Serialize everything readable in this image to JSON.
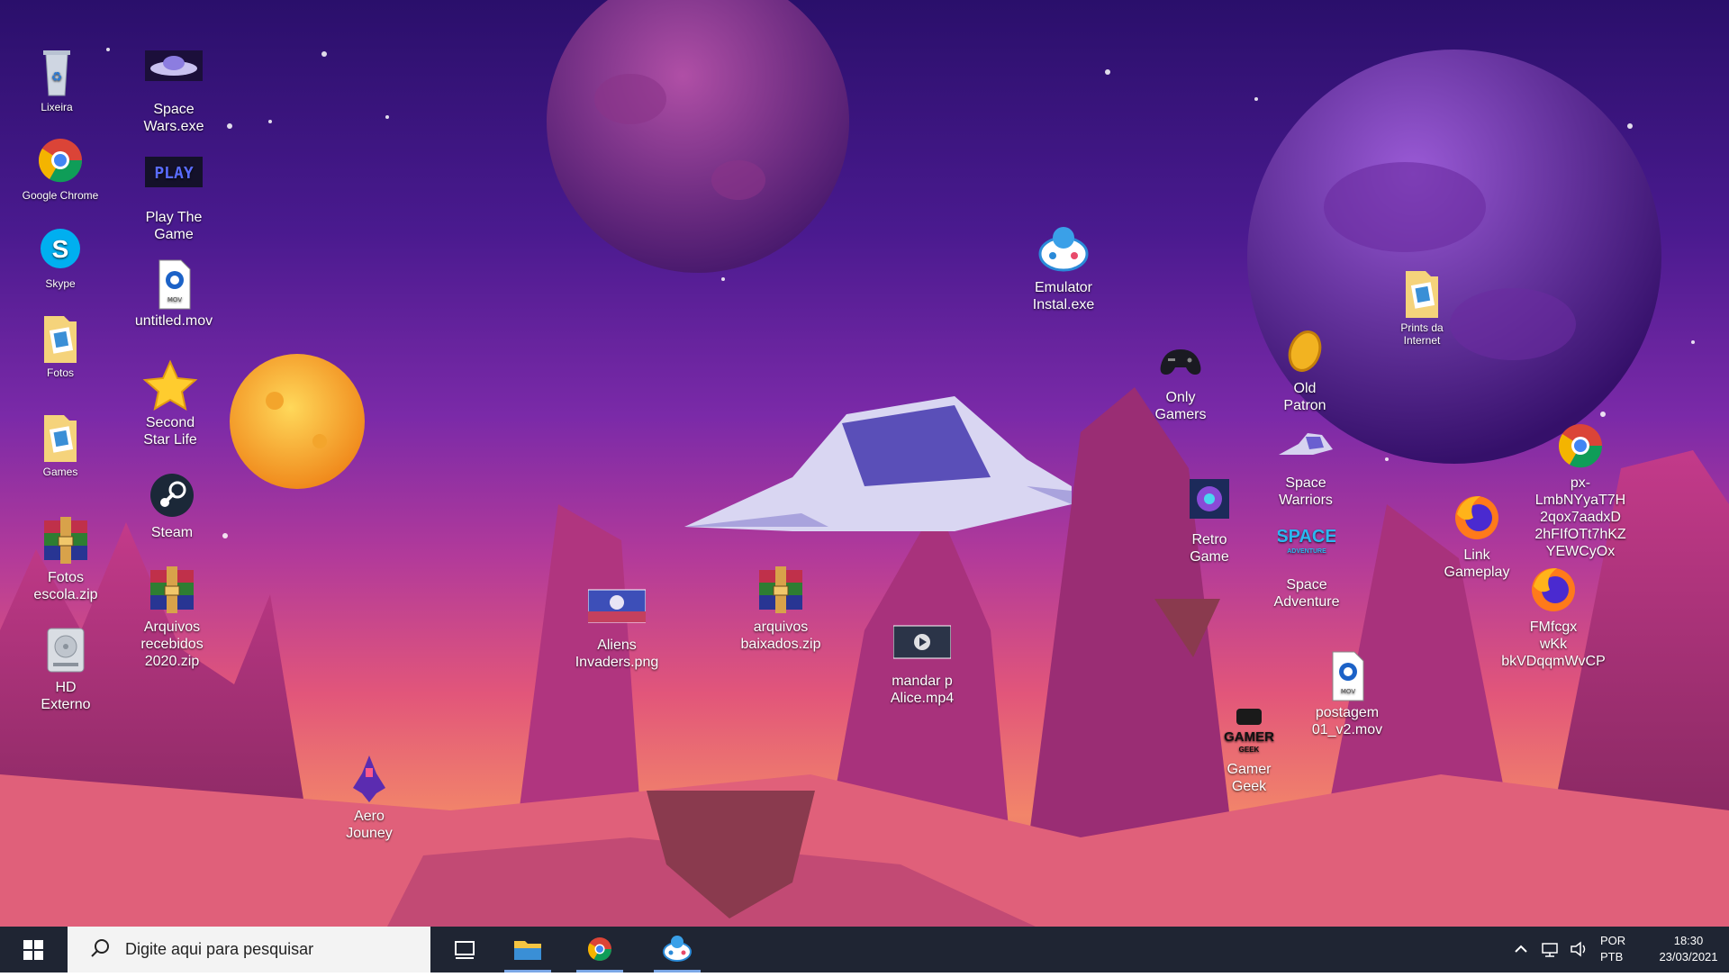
{
  "desktop": {
    "icons": [
      {
        "id": "lixeira",
        "label": "Lixeira",
        "icon": "recycle-bin-icon",
        "small": true
      },
      {
        "id": "chrome",
        "label": "Google Chrome",
        "icon": "chrome-icon",
        "small": true
      },
      {
        "id": "skype",
        "label": "Skype",
        "icon": "skype-icon",
        "small": true
      },
      {
        "id": "fotos",
        "label": "Fotos",
        "icon": "folder-icon",
        "small": true
      },
      {
        "id": "games",
        "label": "Games",
        "icon": "folder-icon",
        "small": true
      },
      {
        "id": "fotos-zip",
        "label": "Fotos\nescola.zip",
        "icon": "winrar-archive-icon",
        "small": false
      },
      {
        "id": "hd-externo",
        "label": "HD\nExterno",
        "icon": "hard-drive-icon",
        "small": false
      },
      {
        "id": "space-wars",
        "label": "Space\nWars.exe",
        "icon": "ufo-icon",
        "small": false
      },
      {
        "id": "play-the-game",
        "label": "Play The\nGame",
        "icon": "play-logo-icon",
        "small": false
      },
      {
        "id": "untitled-mov",
        "label": "untitled.mov",
        "icon": "quicktime-file-icon",
        "small": false
      },
      {
        "id": "second-star",
        "label": "Second\nStar Life",
        "icon": "star-icon",
        "small": false
      },
      {
        "id": "steam",
        "label": "Steam",
        "icon": "steam-icon",
        "small": false
      },
      {
        "id": "arquivos-recebidos",
        "label": "Arquivos\nrecebidos\n2020.zip",
        "icon": "winrar-archive-icon",
        "small": false
      },
      {
        "id": "aero-jouney",
        "label": "Aero\nJouney",
        "icon": "pixel-spaceship-icon",
        "small": false
      },
      {
        "id": "aliens-invaders",
        "label": "Aliens\nInvaders.png",
        "icon": "image-thumbnail-icon",
        "small": false
      },
      {
        "id": "arquivos-baixados",
        "label": "arquivos\nbaixados.zip",
        "icon": "winrar-archive-icon",
        "small": false
      },
      {
        "id": "mandar-alice",
        "label": "mandar p\nAlice.mp4",
        "icon": "video-thumbnail-icon",
        "small": false
      },
      {
        "id": "emulator",
        "label": "Emulator\nInstal.exe",
        "icon": "gamepad-mascot-icon",
        "small": false
      },
      {
        "id": "only-gamers",
        "label": "Only\nGamers",
        "icon": "controller-icon",
        "small": false
      },
      {
        "id": "old-patron",
        "label": "Old\nPatron",
        "icon": "coin-icon",
        "small": false
      },
      {
        "id": "prints",
        "label": "Prints da\nInternet",
        "icon": "folder-icon",
        "small": true
      },
      {
        "id": "space-warriors",
        "label": "Space\nWarriors",
        "icon": "spaceship-icon",
        "small": false
      },
      {
        "id": "retro-game",
        "label": "Retro\nGame",
        "icon": "retro-game-logo-icon",
        "small": false
      },
      {
        "id": "space-adventure",
        "label": "Space\nAdventure",
        "icon": "space-adventure-logo-icon",
        "small": false
      },
      {
        "id": "link-gameplay",
        "label": "Link\nGameplay",
        "icon": "firefox-icon",
        "small": false
      },
      {
        "id": "px-chrome",
        "label": "px-LmbNYyaT7H\n2qox7aadxD\n2hFIfOTt7hKZ\nYEWCyOx",
        "icon": "chrome-icon",
        "small": false
      },
      {
        "id": "fmfcgx",
        "label": "FMfcgx\nwKk\nbkVDqqmWvCP",
        "icon": "firefox-icon",
        "small": false
      },
      {
        "id": "postagem",
        "label": "postagem\n01_v2.mov",
        "icon": "quicktime-file-icon",
        "small": false
      },
      {
        "id": "gamer-geek",
        "label": "Gamer\nGeek",
        "icon": "gamer-geek-logo-icon",
        "small": false
      }
    ],
    "logo_texts": {
      "play": "PLAY",
      "space": "SPACE",
      "adventure": "ADVENTURE",
      "gamer": "GAMER",
      "geek": "GEEK",
      "mov": "MOV"
    }
  },
  "taskbar": {
    "search_placeholder": "Digite aqui para pesquisar",
    "apps": [
      "task-view",
      "file-explorer",
      "chrome",
      "emulator"
    ],
    "tray": {
      "lang_top": "POR",
      "lang_bottom": "PTB",
      "time": "18:30",
      "date": "23/03/2021"
    }
  },
  "colors": {
    "taskbar": "#1f2533",
    "accent_underline": "#7aa7e6",
    "sky_top": "#2a0f6b",
    "sky_bottom": "#f2856a"
  }
}
